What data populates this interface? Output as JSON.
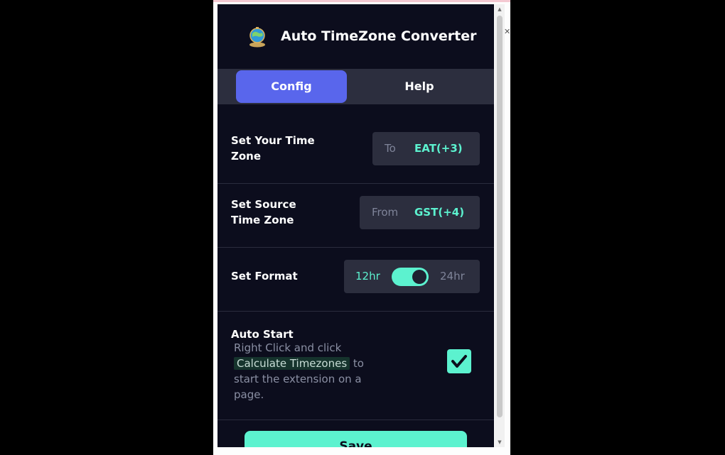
{
  "header": {
    "title": "Auto TimeZone Converter"
  },
  "tabs": [
    {
      "label": "Config",
      "active": true
    },
    {
      "label": "Help",
      "active": false
    }
  ],
  "settings": {
    "your_time_zone": {
      "label": "Set Your Time Zone",
      "prefix": "To",
      "value": "EAT(+3)"
    },
    "source_time_zone": {
      "label": "Set Source Time Zone",
      "prefix": "From",
      "value": "GST(+4)"
    },
    "format": {
      "label": "Set Format",
      "option_left": "12hr",
      "option_right": "24hr",
      "toggle_on": true
    },
    "auto_start": {
      "label": "Auto Start",
      "desc_before": "Right Click and click",
      "desc_highlight": "Calculate Timezones",
      "desc_after": "to start the extension on a page.",
      "checked": true
    }
  },
  "save_label": "Save",
  "colors": {
    "accent": "#5cf2cf",
    "tab_active": "#5966ec",
    "background": "#0c0d1d",
    "pill": "#2c2e3e"
  }
}
